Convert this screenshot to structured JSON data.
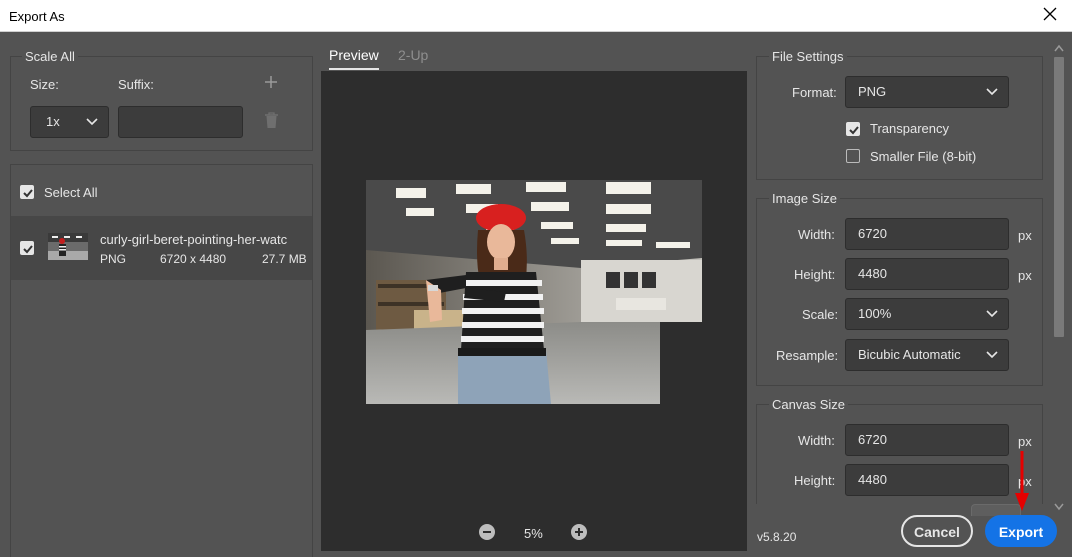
{
  "window": {
    "title": "Export As"
  },
  "scale_all": {
    "legend": "Scale All",
    "size_label": "Size:",
    "suffix_label": "Suffix:",
    "size_value": "1x",
    "suffix_value": ""
  },
  "assets": {
    "select_all_label": "Select All",
    "items": [
      {
        "name": "curly-girl-beret-pointing-her-watc",
        "format": "PNG",
        "dimensions": "6720 x 4480",
        "filesize": "27.7 MB"
      }
    ]
  },
  "tabs": {
    "preview": "Preview",
    "two_up": "2-Up"
  },
  "zoom": {
    "level": "5%"
  },
  "file_settings": {
    "legend": "File Settings",
    "format_label": "Format:",
    "format_value": "PNG",
    "transparency_label": "Transparency",
    "transparency_checked": true,
    "smaller_file_label": "Smaller File (8-bit)",
    "smaller_file_checked": false
  },
  "image_size": {
    "legend": "Image Size",
    "width_label": "Width:",
    "width_value": "6720",
    "height_label": "Height:",
    "height_value": "4480",
    "unit": "px",
    "scale_label": "Scale:",
    "scale_value": "100%",
    "resample_label": "Resample:",
    "resample_value": "Bicubic Automatic"
  },
  "canvas_size": {
    "legend": "Canvas Size",
    "width_label": "Width:",
    "width_value": "6720",
    "height_label": "Height:",
    "height_value": "4480",
    "unit": "px"
  },
  "footer": {
    "version": "v5.8.20",
    "cancel_label": "Cancel",
    "export_label": "Export"
  },
  "colors": {
    "accent": "#1473e6",
    "annotation_arrow": "#e60000",
    "dialog_bg": "#535353",
    "preview_bg": "#2d2d2d"
  }
}
